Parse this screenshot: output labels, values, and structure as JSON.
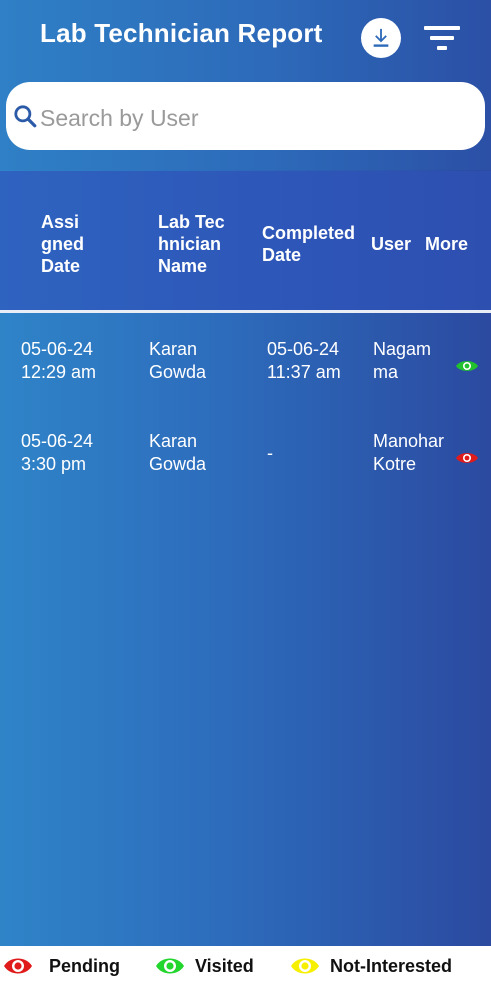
{
  "header": {
    "title": "Lab Technician Report",
    "download_icon": "download-icon",
    "filter_icon": "filter-icon"
  },
  "search": {
    "placeholder": "Search by User",
    "value": ""
  },
  "table": {
    "columns": {
      "assigned_date": "Assi\ngned\nDate",
      "lab_technician_name": "Lab Tec\nhnician\nName",
      "completed_date": "Completed\nDate",
      "user": "User",
      "more": "More"
    },
    "rows": [
      {
        "assigned_date": "05-06-24\n12:29 am",
        "lab_technician_name": "Karan\nGowda",
        "completed_date": "05-06-24\n11:37 am",
        "user": "Nagam\nma",
        "status": "Visited",
        "status_color": "#22c22e"
      },
      {
        "assigned_date": "05-06-24\n3:30 pm",
        "lab_technician_name": "Karan\nGowda",
        "completed_date": "-",
        "user": "Manohar\nKotre",
        "status": "Pending",
        "status_color": "#e01b1b"
      }
    ]
  },
  "legend": [
    {
      "label": "Pending",
      "color": "#e01b1b",
      "icon": "eye-icon"
    },
    {
      "label": "Visited",
      "color": "#22d62e",
      "icon": "eye-icon"
    },
    {
      "label": "Not-Interested",
      "color": "#f6f000",
      "icon": "eye-icon"
    }
  ],
  "colors": {
    "header_gradient_start": "#2f80c6",
    "header_gradient_end": "#2b50a6",
    "table_header": "#2d56b8",
    "search_background": "#ffffff",
    "legend_background": "#ffffff"
  }
}
